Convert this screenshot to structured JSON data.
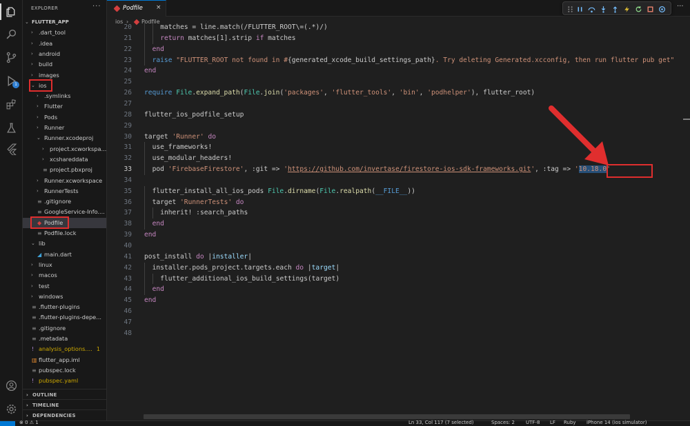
{
  "activity_bar": {
    "debug_badge": "1"
  },
  "sidebar": {
    "title": "EXPLORER",
    "more": "···",
    "tree": [
      {
        "label": "FLUTTER_APP",
        "depth": 0,
        "expanded": true,
        "kind": "root"
      },
      {
        "label": ".dart_tool",
        "depth": 1,
        "kind": "folder"
      },
      {
        "label": ".idea",
        "depth": 1,
        "kind": "folder"
      },
      {
        "label": "android",
        "depth": 1,
        "kind": "folder"
      },
      {
        "label": "build",
        "depth": 1,
        "kind": "folder"
      },
      {
        "label": "images",
        "depth": 1,
        "kind": "folder"
      },
      {
        "label": "ios",
        "depth": 1,
        "kind": "folder",
        "expanded": true
      },
      {
        "label": ".symlinks",
        "depth": 2,
        "kind": "folder"
      },
      {
        "label": "Flutter",
        "depth": 2,
        "kind": "folder"
      },
      {
        "label": "Pods",
        "depth": 2,
        "kind": "folder"
      },
      {
        "label": "Runner",
        "depth": 2,
        "kind": "folder"
      },
      {
        "label": "Runner.xcodeproj",
        "depth": 2,
        "kind": "folder",
        "expanded": true
      },
      {
        "label": "project.xcworkspa...",
        "depth": 3,
        "kind": "folder"
      },
      {
        "label": "xcshareddata",
        "depth": 3,
        "kind": "folder"
      },
      {
        "label": "project.pbxproj",
        "depth": 3,
        "kind": "file"
      },
      {
        "label": "Runner.xcworkspace",
        "depth": 2,
        "kind": "folder"
      },
      {
        "label": "RunnerTests",
        "depth": 2,
        "kind": "folder"
      },
      {
        "label": ".gitignore",
        "depth": 2,
        "kind": "file"
      },
      {
        "label": "GoogleService-Info....",
        "depth": 2,
        "kind": "file"
      },
      {
        "label": "Podfile",
        "depth": 2,
        "kind": "ruby",
        "selected": true
      },
      {
        "label": "Podfile.lock",
        "depth": 2,
        "kind": "file"
      },
      {
        "label": "lib",
        "depth": 1,
        "kind": "folder",
        "expanded": true
      },
      {
        "label": "main.dart",
        "depth": 2,
        "kind": "dart"
      },
      {
        "label": "linux",
        "depth": 1,
        "kind": "folder"
      },
      {
        "label": "macos",
        "depth": 1,
        "kind": "folder"
      },
      {
        "label": "test",
        "depth": 1,
        "kind": "folder"
      },
      {
        "label": "windows",
        "depth": 1,
        "kind": "folder"
      },
      {
        "label": ".flutter-plugins",
        "depth": 1,
        "kind": "file"
      },
      {
        "label": ".flutter-plugins-depe...",
        "depth": 1,
        "kind": "file"
      },
      {
        "label": ".gitignore",
        "depth": 1,
        "kind": "file"
      },
      {
        "label": ".metadata",
        "depth": 1,
        "kind": "file"
      },
      {
        "label": "analysis_options....",
        "depth": 1,
        "kind": "warn",
        "count": "1"
      },
      {
        "label": "flutter_app.iml",
        "depth": 1,
        "kind": "file"
      },
      {
        "label": "pubspec.lock",
        "depth": 1,
        "kind": "file"
      },
      {
        "label": "pubspec.yaml",
        "depth": 1,
        "kind": "warn-yaml"
      }
    ],
    "sections": [
      "OUTLINE",
      "TIMELINE",
      "DEPENDENCIES"
    ]
  },
  "tab": {
    "label": "Podfile",
    "close": "×"
  },
  "breadcrumb": {
    "folder": "ios",
    "separator": "›",
    "file": "Podfile"
  },
  "code_lines": [
    {
      "n": "20",
      "indent": 2,
      "tokens": [
        [
          "",
          "matches = line.match(/FLUTTER_ROOT\\=(.*)/)"
        ]
      ]
    },
    {
      "n": "21",
      "indent": 2,
      "tokens": [
        [
          "kw",
          "return"
        ],
        [
          "",
          " matches[1].strip "
        ],
        [
          "kw",
          "if"
        ],
        [
          "",
          " matches"
        ]
      ]
    },
    {
      "n": "22",
      "indent": 1,
      "tokens": [
        [
          "kw",
          "end"
        ]
      ]
    },
    {
      "n": "23",
      "indent": 1,
      "tokens": [
        [
          "bi",
          "raise"
        ],
        [
          "str",
          " \"FLUTTER_ROOT not found in #"
        ],
        [
          "",
          "{generated_xcode_build_settings_path}"
        ],
        [
          "str",
          ". Try deleting Generated.xcconfig, then run flutter pub get\""
        ]
      ]
    },
    {
      "n": "24",
      "indent": 0,
      "tokens": [
        [
          "kw",
          "end"
        ]
      ]
    },
    {
      "n": "25",
      "indent": 0,
      "tokens": []
    },
    {
      "n": "26",
      "indent": 0,
      "tokens": [
        [
          "bi",
          "require"
        ],
        [
          "",
          " "
        ],
        [
          "cls",
          "File"
        ],
        [
          "",
          "."
        ],
        [
          "fn",
          "expand_path"
        ],
        [
          "",
          "("
        ],
        [
          "cls",
          "File"
        ],
        [
          "",
          "."
        ],
        [
          "fn",
          "join"
        ],
        [
          "",
          "("
        ],
        [
          "str",
          "'packages'"
        ],
        [
          "",
          ", "
        ],
        [
          "str",
          "'flutter_tools'"
        ],
        [
          "",
          ", "
        ],
        [
          "str",
          "'bin'"
        ],
        [
          "",
          ", "
        ],
        [
          "str",
          "'podhelper'"
        ],
        [
          "",
          "), flutter_root)"
        ]
      ]
    },
    {
      "n": "27",
      "indent": 0,
      "tokens": []
    },
    {
      "n": "28",
      "indent": 0,
      "tokens": [
        [
          "",
          "flutter_ios_podfile_setup"
        ]
      ]
    },
    {
      "n": "29",
      "indent": 0,
      "tokens": []
    },
    {
      "n": "30",
      "indent": 0,
      "tokens": [
        [
          "",
          "target "
        ],
        [
          "str",
          "'Runner'"
        ],
        [
          "",
          " "
        ],
        [
          "kw",
          "do"
        ]
      ]
    },
    {
      "n": "31",
      "indent": 1,
      "tokens": [
        [
          "",
          "use_frameworks!"
        ]
      ]
    },
    {
      "n": "32",
      "indent": 1,
      "tokens": [
        [
          "",
          "use_modular_headers!"
        ]
      ]
    },
    {
      "n": "33",
      "indent": 1,
      "current": true,
      "tokens": [
        [
          "",
          "pod "
        ],
        [
          "str",
          "'FirebaseFirestore'"
        ],
        [
          "",
          ", :git => "
        ],
        [
          "str",
          "'"
        ],
        [
          "url",
          "https://github.com/invertase/firestore-ios-sdk-frameworks.git"
        ],
        [
          "str",
          "'"
        ],
        [
          "",
          ", :tag => "
        ],
        [
          "str",
          "'"
        ],
        [
          "sel",
          "10.18.0"
        ],
        [
          "str",
          "'"
        ]
      ]
    },
    {
      "n": "34",
      "indent": 0,
      "tokens": []
    },
    {
      "n": "35",
      "indent": 1,
      "tokens": [
        [
          "",
          "flutter_install_all_ios_pods "
        ],
        [
          "cls",
          "File"
        ],
        [
          "",
          "."
        ],
        [
          "fn",
          "dirname"
        ],
        [
          "",
          "("
        ],
        [
          "cls",
          "File"
        ],
        [
          "",
          "."
        ],
        [
          "fn",
          "realpath"
        ],
        [
          "",
          "("
        ],
        [
          "bi",
          "__FILE__"
        ],
        [
          "",
          "))"
        ]
      ]
    },
    {
      "n": "36",
      "indent": 1,
      "tokens": [
        [
          "",
          "target "
        ],
        [
          "str",
          "'RunnerTests'"
        ],
        [
          "",
          " "
        ],
        [
          "kw",
          "do"
        ]
      ]
    },
    {
      "n": "37",
      "indent": 2,
      "tokens": [
        [
          "",
          "inherit! :search_paths"
        ]
      ]
    },
    {
      "n": "38",
      "indent": 1,
      "tokens": [
        [
          "kw",
          "end"
        ]
      ]
    },
    {
      "n": "39",
      "indent": 0,
      "tokens": [
        [
          "kw",
          "end"
        ]
      ]
    },
    {
      "n": "40",
      "indent": 0,
      "tokens": []
    },
    {
      "n": "41",
      "indent": 0,
      "tokens": [
        [
          "",
          "post_install "
        ],
        [
          "kw",
          "do"
        ],
        [
          "",
          " |"
        ],
        [
          "var",
          "installer"
        ],
        [
          "",
          "|"
        ]
      ]
    },
    {
      "n": "42",
      "indent": 1,
      "tokens": [
        [
          "",
          "installer.pods_project.targets.each "
        ],
        [
          "kw",
          "do"
        ],
        [
          "",
          " |"
        ],
        [
          "var",
          "target"
        ],
        [
          "",
          "|"
        ]
      ]
    },
    {
      "n": "43",
      "indent": 2,
      "tokens": [
        [
          "",
          "flutter_additional_ios_build_settings(target)"
        ]
      ]
    },
    {
      "n": "44",
      "indent": 1,
      "tokens": [
        [
          "kw",
          "end"
        ]
      ]
    },
    {
      "n": "45",
      "indent": 0,
      "tokens": [
        [
          "kw",
          "end"
        ]
      ]
    },
    {
      "n": "46",
      "indent": 0,
      "tokens": []
    },
    {
      "n": "47",
      "indent": 0,
      "tokens": []
    },
    {
      "n": "48",
      "indent": 0,
      "tokens": []
    }
  ],
  "status_bar": {
    "problems": "⊗ 0 ⚠ 1",
    "position": "Ln 33, Col 117 (7 selected)",
    "spaces": "Spaces: 2",
    "encoding": "UTF-8",
    "eol": "LF",
    "language": "Ruby",
    "device": "iPhone 14 (ios simulator)"
  },
  "colors": {
    "accent": "#0078d4",
    "annotation": "#e02e2e",
    "selection": "#264f78"
  }
}
